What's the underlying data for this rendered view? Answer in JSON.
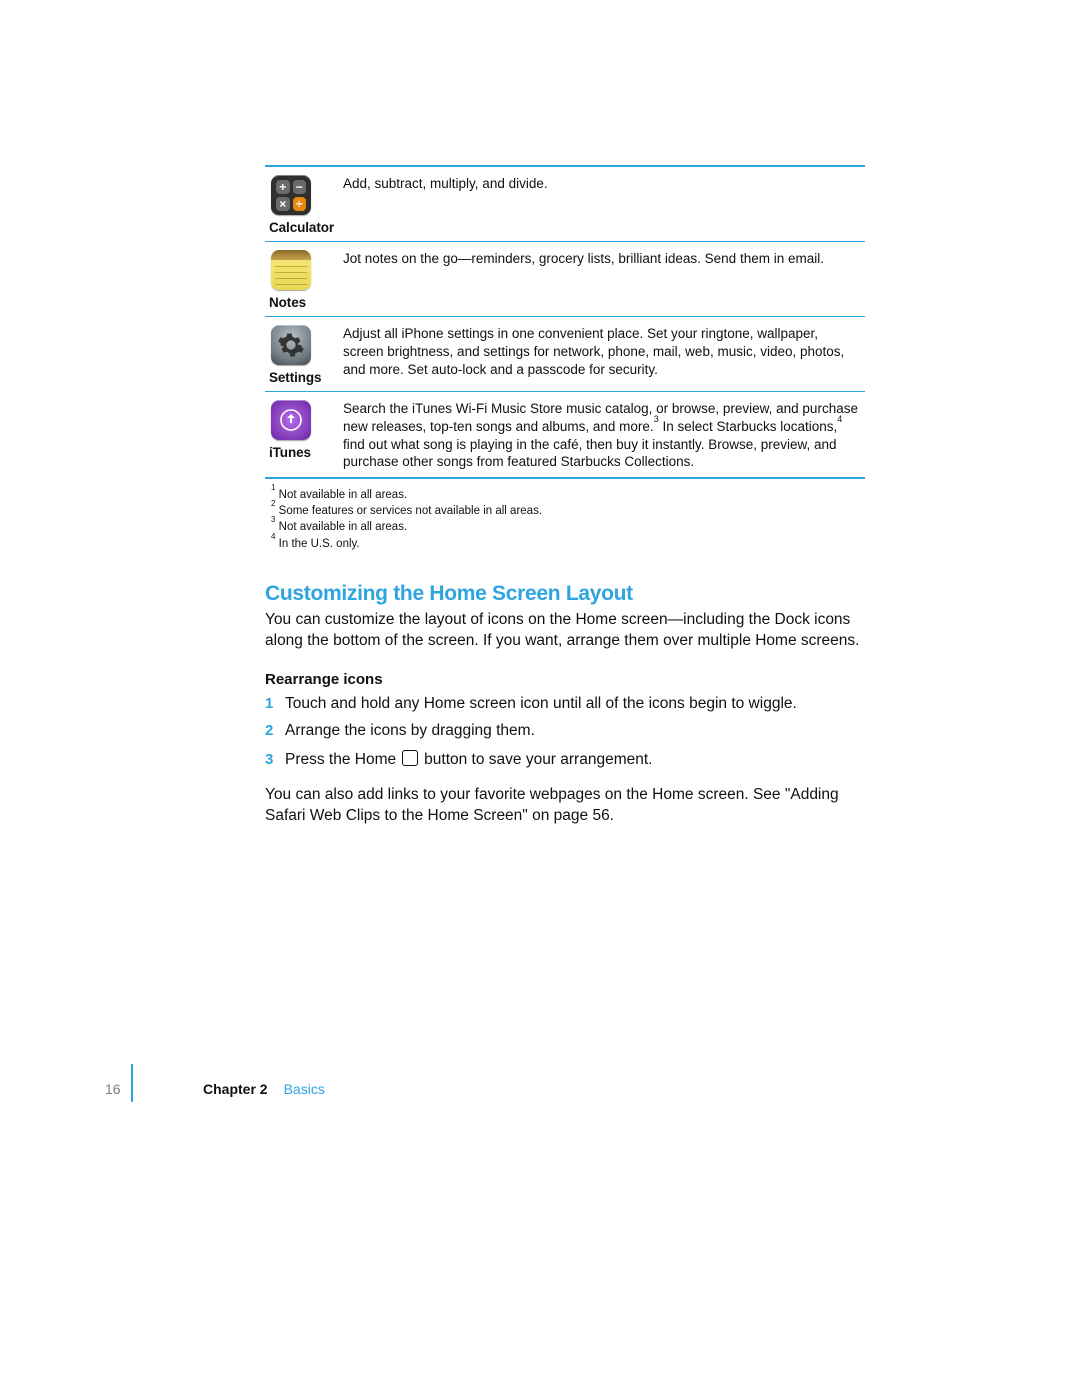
{
  "apps": [
    {
      "name": "Calculator",
      "description": "Add, subtract, multiply, and divide."
    },
    {
      "name": "Notes",
      "description": "Jot notes on the go—reminders, grocery lists, brilliant ideas. Send them in email."
    },
    {
      "name": "Settings",
      "description": "Adjust all iPhone settings in one convenient place. Set your ringtone, wallpaper, screen brightness, and settings for network, phone, mail, web, music, video, photos, and more. Set auto-lock and a passcode for security."
    },
    {
      "name": "iTunes",
      "desc_part1": "Search the iTunes Wi-Fi Music Store music catalog, or browse, preview, and purchase new releases, top-ten songs and albums, and more.",
      "sup1": "3",
      "desc_part2": " In select Starbucks locations,",
      "sup2": "4",
      "desc_part3": " find out what song is playing in the café, then buy it instantly. Browse, preview, and purchase other songs from featured Starbucks Collections."
    }
  ],
  "footnotes": [
    {
      "n": "1",
      "text": "Not available in all areas."
    },
    {
      "n": "2",
      "text": "Some features or services not available in all areas."
    },
    {
      "n": "3",
      "text": "Not available in all areas."
    },
    {
      "n": "4",
      "text": "In the U.S. only."
    }
  ],
  "section_heading": "Customizing the Home Screen Layout",
  "section_body": "You can customize the layout of icons on the Home screen—including the Dock icons along the bottom of the screen. If you want, arrange them over multiple Home screens.",
  "sub_heading": "Rearrange icons",
  "steps": {
    "s1": "Touch and hold any Home screen icon until all of the icons begin to wiggle.",
    "s2": "Arrange the icons by dragging them.",
    "s3_a": "Press the Home ",
    "s3_b": " button to save your arrangement."
  },
  "step_nums": [
    "1",
    "2",
    "3"
  ],
  "body_after": "You can also add links to your favorite webpages on the Home screen. See \"Adding Safari Web Clips to the Home Screen\" on page 56.",
  "footer": {
    "page": "16",
    "chapter_label": "Chapter 2",
    "chapter_name": "Basics"
  }
}
